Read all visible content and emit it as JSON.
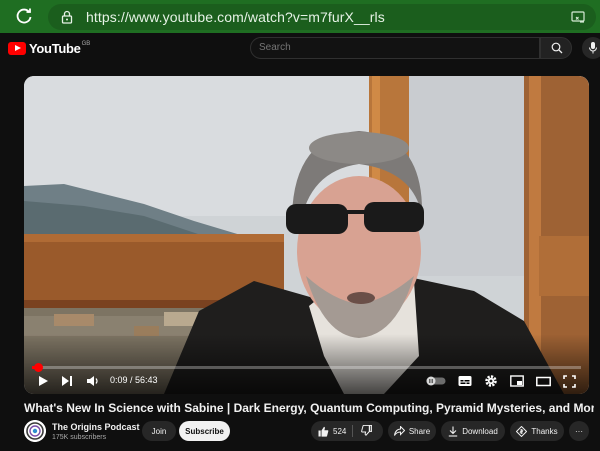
{
  "browser": {
    "url": "https://www.youtube.com/watch?v=m7furX__rls",
    "icons": [
      "reload-icon",
      "lock-icon",
      "cast-icon"
    ]
  },
  "header": {
    "logo_text": "YouTube",
    "country_code": "GB",
    "search_placeholder": "Search",
    "icons": [
      "search-icon",
      "microphone-icon"
    ]
  },
  "player": {
    "current_time": "0:09",
    "duration": "56:43",
    "time_display": "0:09 / 56:43",
    "progress_fraction": 0.0026,
    "icons": [
      "play-icon",
      "next-icon",
      "volume-icon",
      "autoplay-toggle",
      "subtitles-icon",
      "settings-icon",
      "miniplayer-icon",
      "theater-icon",
      "fullscreen-icon"
    ]
  },
  "video": {
    "title": "What's New In Science with Sabine | Dark Energy, Quantum Computing, Pyramid Mysteries, and More!",
    "channel_name": "The Origins Podcast",
    "subscribers": "175K subscribers",
    "join_label": "Join",
    "subscribe_label": "Subscribe",
    "like_count": "524",
    "share_label": "Share",
    "download_label": "Download",
    "thanks_label": "Thanks",
    "more_label": "···"
  },
  "colors": {
    "browser_bar": "#1f6e22",
    "yt_background": "#0f0f0f",
    "brand_red": "#ff0000",
    "button_bg": "#272727"
  }
}
